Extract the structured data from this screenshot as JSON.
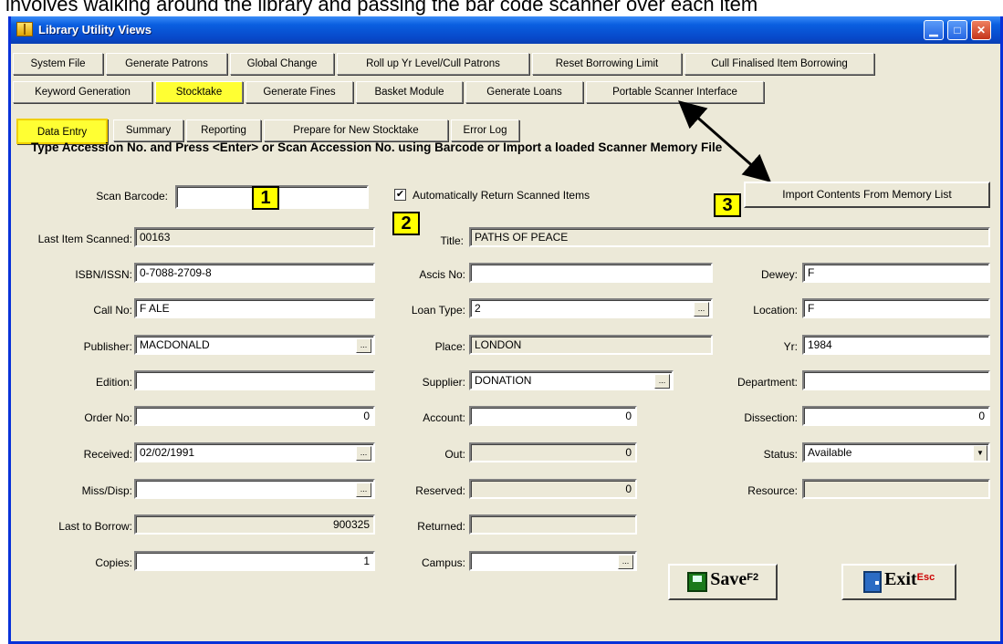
{
  "caption": "involves walking around the library and passing the bar code scanner over each item",
  "window": {
    "title": "Library Utility Views",
    "controls": {
      "minimize": "▁",
      "maximize": "□",
      "close": "✕"
    }
  },
  "tabs_row1": [
    "System File",
    "Generate Patrons",
    "Global Change",
    "Roll up Yr Level/Cull Patrons",
    "Reset Borrowing Limit",
    "Cull Finalised Item Borrowing"
  ],
  "tabs_row2": [
    "Keyword Generation",
    "Stocktake",
    "Generate Fines",
    "Basket Module",
    "Generate Loans",
    "Portable Scanner Interface"
  ],
  "tabs_row3": [
    "Data Entry",
    "Summary",
    "Reporting",
    "Prepare for New Stocktake",
    "Error Log"
  ],
  "instruction": "Type Accession No. and Press <Enter> or Scan Accession No. using Barcode or  Import a loaded Scanner Memory File",
  "scan": {
    "barcode_label": "Scan Barcode:",
    "barcode_value": "",
    "auto_return_label": "Automatically Return Scanned Items",
    "auto_return_checked": "✔",
    "import_button": "Import Contents From Memory List",
    "last_item_label": "Last Item Scanned:",
    "last_item_value": "00163",
    "title_label": "Title:",
    "title_value": "PATHS OF PEACE"
  },
  "badges": [
    "1",
    "2",
    "3"
  ],
  "left": {
    "isbn_label": "ISBN/ISSN:",
    "isbn": "0-7088-2709-8",
    "callno_label": "Call No:",
    "callno": "F ALE",
    "publisher_label": "Publisher:",
    "publisher": "MACDONALD",
    "edition_label": "Edition:",
    "edition": "",
    "orderno_label": "Order No:",
    "orderno": "0",
    "received_label": "Received:",
    "received": "02/02/1991",
    "missdisp_label": "Miss/Disp:",
    "missdisp": "",
    "lastborrow_label": "Last to Borrow:",
    "lastborrow": "900325",
    "copies_label": "Copies:",
    "copies": "1"
  },
  "middle": {
    "ascis_label": "Ascis No:",
    "ascis": "",
    "loantype_label": "Loan Type:",
    "loantype": "2",
    "place_label": "Place:",
    "place": "LONDON",
    "supplier_label": "Supplier:",
    "supplier": "DONATION",
    "account_label": "Account:",
    "account": "0",
    "out_label": "Out:",
    "out": "0",
    "reserved_label": "Reserved:",
    "reserved": "0",
    "returned_label": "Returned:",
    "returned": "",
    "campus_label": "Campus:",
    "campus": ""
  },
  "right": {
    "dewey_label": "Dewey:",
    "dewey": "F",
    "location_label": "Location:",
    "location": "F",
    "yr_label": "Yr:",
    "yr": "1984",
    "department_label": "Department:",
    "department": "",
    "dissection_label": "Dissection:",
    "dissection": "0",
    "status_label": "Status:",
    "status": "Available",
    "resource_label": "Resource:",
    "resource": ""
  },
  "ellipsis": "...",
  "dropdown_arrow": "▼",
  "save": {
    "label": "Save",
    "key": "F2"
  },
  "exit": {
    "label": "Exit",
    "key": "Esc"
  },
  "colors": {
    "highlight": "#ffff33",
    "titlebar": "#0a5fe0",
    "face": "#ece9d8",
    "exit_key": "#cc0000"
  }
}
